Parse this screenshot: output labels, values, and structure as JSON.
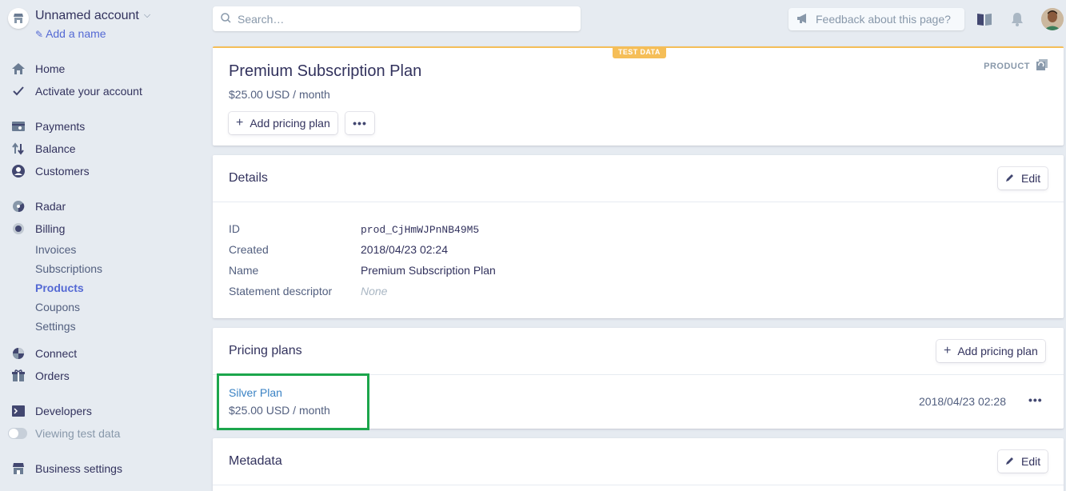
{
  "account": {
    "name": "Unnamed account",
    "add_name": "Add a name"
  },
  "nav": {
    "home": "Home",
    "activate": "Activate your account",
    "payments": "Payments",
    "balance": "Balance",
    "customers": "Customers",
    "radar": "Radar",
    "billing": "Billing",
    "billing_sub": [
      "Invoices",
      "Subscriptions",
      "Products",
      "Coupons",
      "Settings"
    ],
    "billing_active": "Products",
    "connect": "Connect",
    "orders": "Orders",
    "developers": "Developers",
    "test_data": "Viewing test data",
    "business_settings": "Business settings"
  },
  "topbar": {
    "search_placeholder": "Search…",
    "feedback": "Feedback about this page?"
  },
  "product": {
    "badge": "TEST DATA",
    "tag": "PRODUCT",
    "title": "Premium Subscription Plan",
    "price": "$25.00 USD / month",
    "add_pricing_plan": "Add pricing plan",
    "more": "•••"
  },
  "details": {
    "heading": "Details",
    "edit": "Edit",
    "rows": [
      {
        "label": "ID",
        "value": "prod_CjHmWJPnNB49M5"
      },
      {
        "label": "Created",
        "value": "2018/04/23 02:24"
      },
      {
        "label": "Name",
        "value": "Premium Subscription Plan"
      },
      {
        "label": "Statement descriptor",
        "value": "None"
      }
    ]
  },
  "pricing": {
    "heading": "Pricing plans",
    "add_pricing_plan": "Add pricing plan",
    "plans": [
      {
        "name": "Silver Plan",
        "price": "$25.00 USD / month",
        "created": "2018/04/23 02:28",
        "more": "•••"
      }
    ]
  },
  "metadata": {
    "heading": "Metadata",
    "edit": "Edit"
  },
  "colors": {
    "accent": "#5469d4",
    "link": "#3a82c4",
    "test_badge": "#f5be58",
    "highlight": "#1ca64c",
    "background": "#e6ebf1"
  }
}
